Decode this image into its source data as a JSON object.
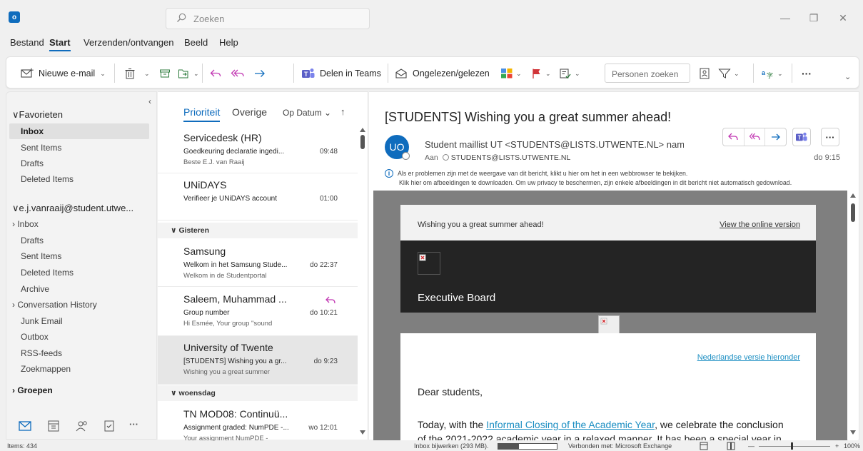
{
  "titlebar": {
    "search_placeholder": "Zoeken",
    "minimize": "—",
    "restore": "❐",
    "close": "✕"
  },
  "menu": {
    "items": [
      "Bestand",
      "Start",
      "Verzenden/ontvangen",
      "Beeld",
      "Help"
    ],
    "active": "Start"
  },
  "ribbon": {
    "new_email": "Nieuwe e-mail",
    "share_teams": "Delen in Teams",
    "unread_read": "Ongelezen/gelezen",
    "people_search_placeholder": "Personen zoeken",
    "more": "···"
  },
  "nav": {
    "favorites_header": "Favorieten",
    "favorites": [
      "Inbox",
      "Sent Items",
      "Drafts",
      "Deleted Items"
    ],
    "account": "e.j.vanraaij@student.utwe...",
    "folders": [
      "Inbox",
      "Drafts",
      "Sent Items",
      "Deleted Items",
      "Archive",
      "Conversation History",
      "Junk Email",
      "Outbox",
      "RSS-feeds",
      "Zoekmappen"
    ],
    "groups": "Groepen",
    "more": "···"
  },
  "msglist": {
    "tab_focused": "Prioriteit",
    "tab_other": "Overige",
    "sort": "Op Datum",
    "sort_arrow": "↑",
    "messages": [
      {
        "sender": "Servicedesk (HR)",
        "subject": "Goedkeuring declaratie ingedi...",
        "time": "09:48",
        "preview": "Beste E.J. van Raaij"
      },
      {
        "sender": "UNiDAYS",
        "subject": "Verifieer je UNiDAYS account",
        "time": "01:00",
        "preview": ""
      },
      {
        "sender": "Samsung",
        "subject": "Welkom in het Samsung Stude...",
        "time": "do 22:37",
        "preview": "Welkom in de Studentportal"
      },
      {
        "sender": "Saleem, Muhammad ...",
        "subject": "Group number",
        "time": "do 10:21",
        "preview": "Hi Esmée,  Your group \"sound"
      },
      {
        "sender": "University of Twente",
        "subject": "[STUDENTS] Wishing you a gr...",
        "time": "do 9:23",
        "preview": "Wishing you a great summer"
      },
      {
        "sender": "TN MOD08: Continuü...",
        "subject": "Assignment graded: NumPDE -...",
        "time": "wo 12:01",
        "preview": "Your assignment NumPDE -"
      }
    ],
    "groups": [
      "Gisteren",
      "woensdag"
    ]
  },
  "reading": {
    "subject": "[STUDENTS] Wishing you a great summer ahead!",
    "avatar_initials": "UO",
    "from": "Student maillist UT <STUDENTS@LISTS.UTWENTE.NL> namens l",
    "to_label": "Aan",
    "to": "STUDENTS@LISTS.UTWENTE.NL",
    "time": "do 9:15",
    "info_line1": "Als er problemen zijn met de weergave van dit bericht, klikt u hier om het in een webbrowser te bekijken.",
    "info_line2": "Klik hier om afbeeldingen te downloaden. Om uw privacy te beschermen, zijn enkele afbeeldingen in dit bericht niet automatisch gedownload.",
    "more": "···",
    "body": {
      "header_left": "Wishing you a great summer ahead!",
      "header_right": "View the online version",
      "banner_title": "Executive Board",
      "dutch_link": "Nederlandse versie hieronder",
      "greeting": "Dear students,",
      "para_prefix": "Today, with the ",
      "para_link": "Informal Closing of the Academic Year",
      "para_suffix": ", we celebrate the conclusion",
      "para2": "of the 2021-2022 academic year in a relaxed manner. It has been a special year in"
    }
  },
  "status": {
    "items": "Items: 434",
    "update": "Inbox bijwerken (293 MB).",
    "update_progress": 0.35,
    "connected": "Verbonden met: Microsoft Exchange",
    "zoom_minus": "—",
    "zoom_plus": "+",
    "zoom": "100%"
  },
  "colors": {
    "accent": "#0f6cbd",
    "reply_pink": "#c239b3",
    "flag_red": "#d13438",
    "teams": "#5b5fc7"
  }
}
